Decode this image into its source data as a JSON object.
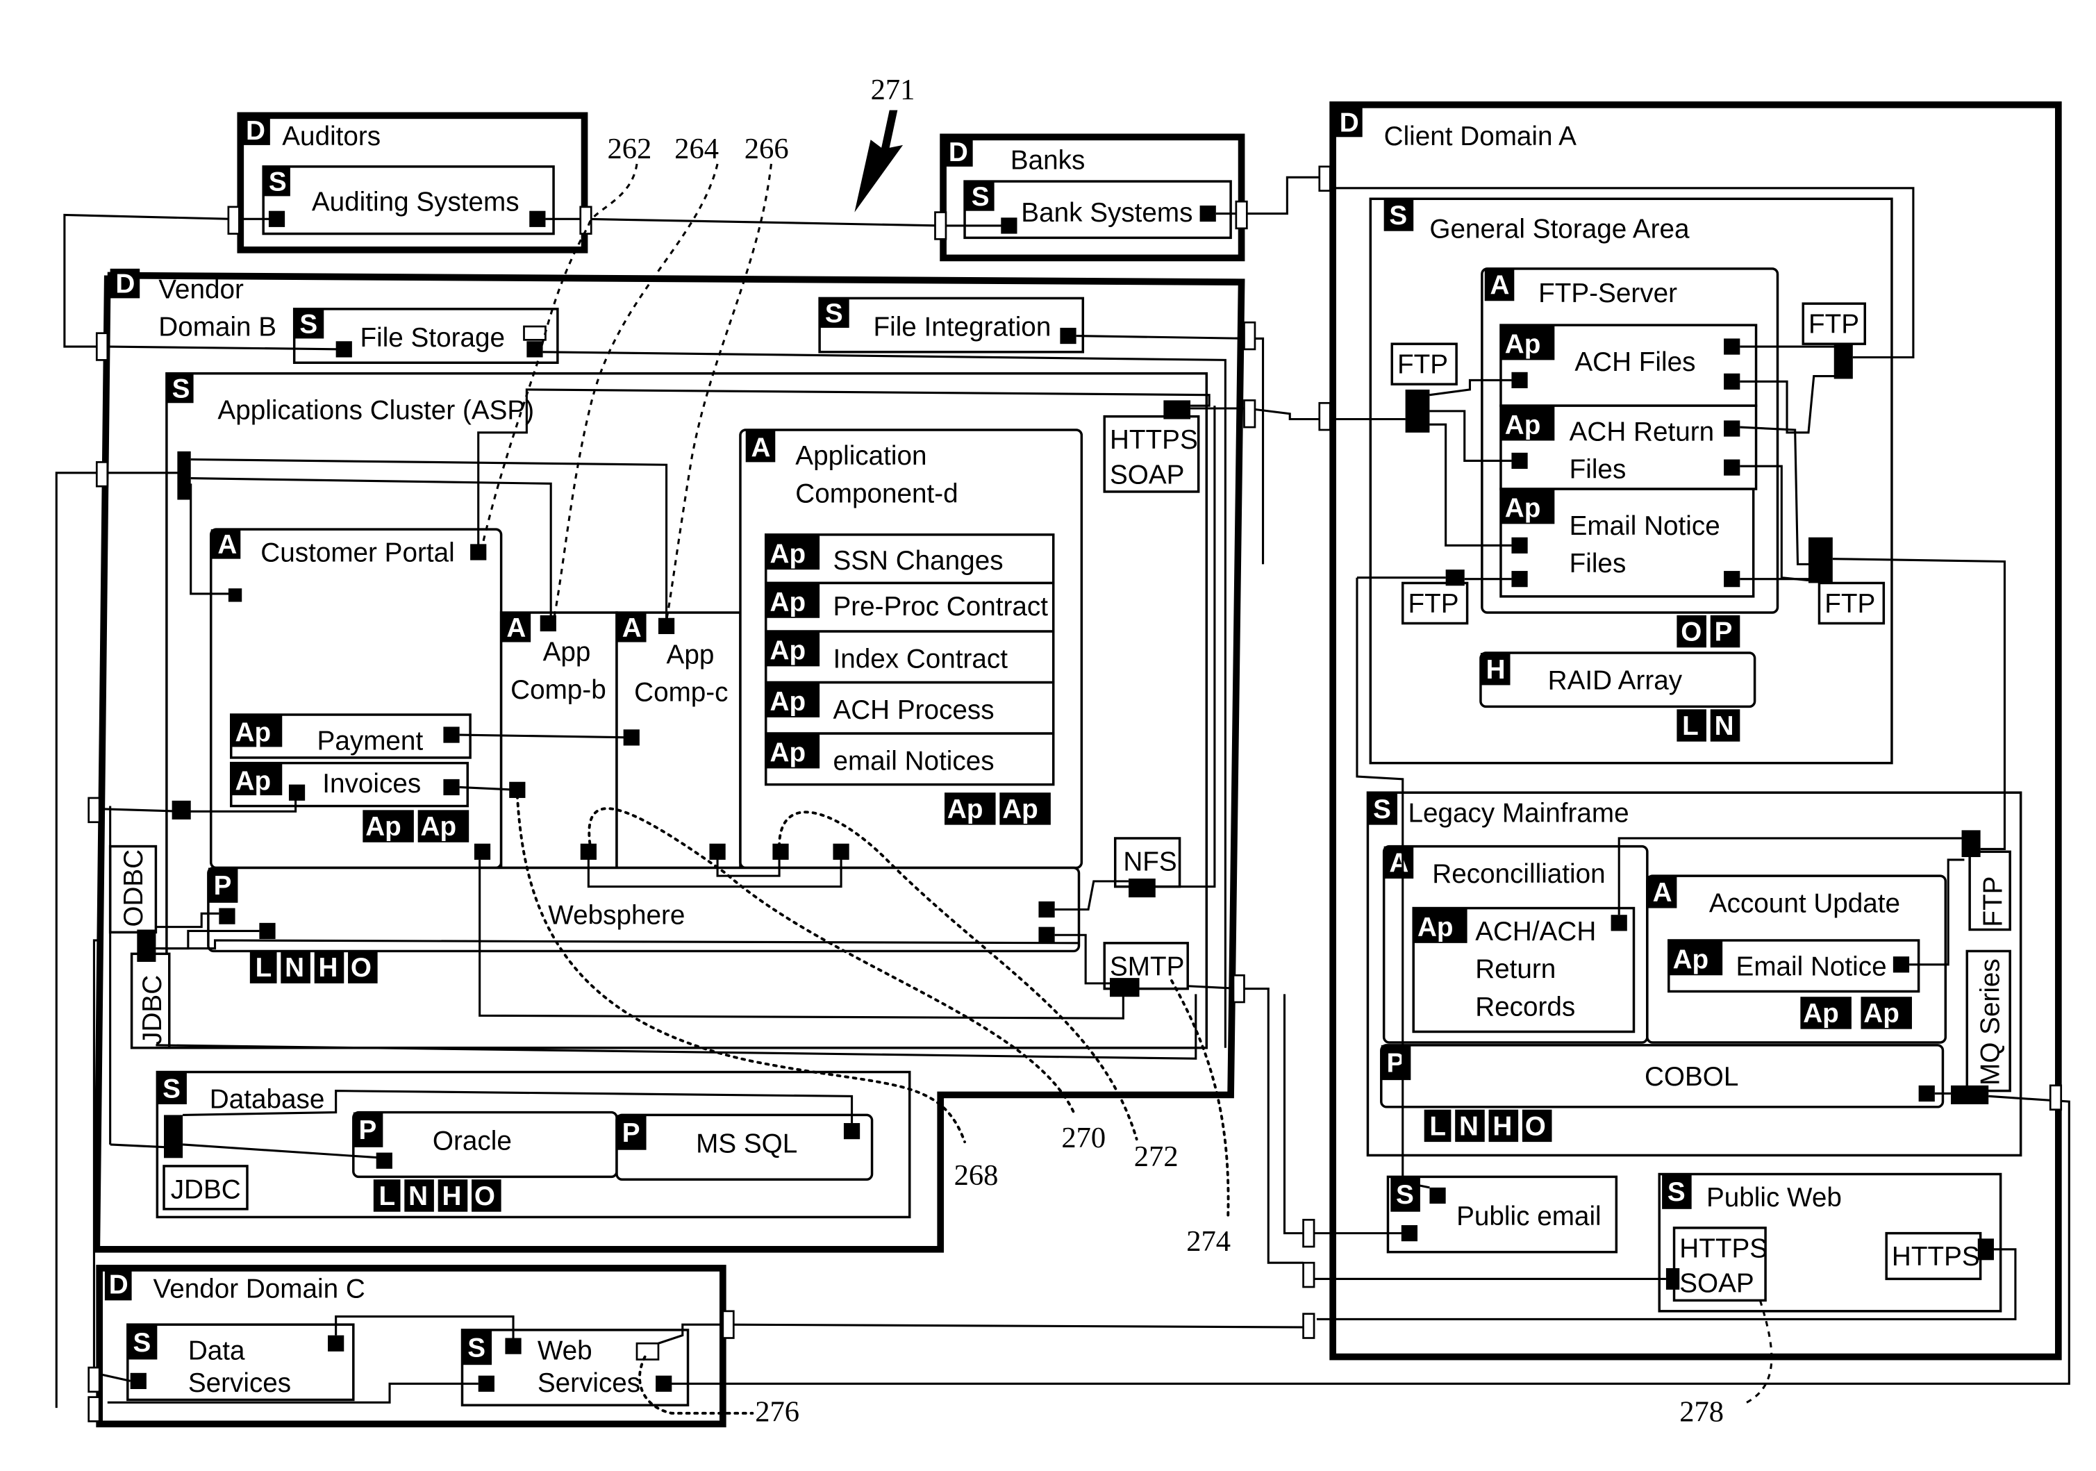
{
  "figure_ref": "271",
  "domains": {
    "auditors": {
      "tag": "D",
      "label": "Auditors",
      "systems": [
        {
          "tag": "S",
          "label": "Auditing Systems"
        }
      ]
    },
    "banks": {
      "tag": "D",
      "label": "Banks",
      "systems": [
        {
          "tag": "S",
          "label": "Bank Systems"
        }
      ]
    },
    "vendor_b": {
      "tag": "D",
      "label_line1": "Vendor",
      "label_line2": "Domain B",
      "file_storage": {
        "tag": "S",
        "label": "File Storage"
      },
      "file_integration": {
        "tag": "S",
        "label": "File Integration"
      },
      "apps_cluster": {
        "tag": "S",
        "label": "Applications Cluster (ASP)",
        "customer_portal": {
          "tag": "A",
          "label": "Customer Portal",
          "apps": [
            {
              "tag": "Ap",
              "label": "Payment"
            },
            {
              "tag": "Ap",
              "label": "Invoices"
            }
          ],
          "extra_tags": [
            "Ap",
            "Ap"
          ]
        },
        "app_comp_b": {
          "tag": "A",
          "line1": "App",
          "line2": "Comp-b"
        },
        "app_comp_c": {
          "tag": "A",
          "line1": "App",
          "line2": "Comp-c"
        },
        "app_comp_d": {
          "tag": "A",
          "line1": "Application",
          "line2": "Component-d",
          "apps": [
            {
              "tag": "Ap",
              "label": "SSN Changes"
            },
            {
              "tag": "Ap",
              "label": "Pre-Proc Contract"
            },
            {
              "tag": "Ap",
              "label": "Index Contract"
            },
            {
              "tag": "Ap",
              "label": "ACH Process"
            },
            {
              "tag": "Ap",
              "label": "email Notices"
            }
          ],
          "extra_tags": [
            "Ap",
            "Ap"
          ]
        },
        "platform": {
          "tag": "P",
          "label": "Websphere",
          "tags": [
            "L",
            "N",
            "H",
            "O"
          ]
        },
        "protocols": {
          "https_soap_1": "HTTPS",
          "https_soap_2": "SOAP",
          "nfs": "NFS",
          "smtp": "SMTP",
          "odbc": "ODBC",
          "jdbc": "JDBC"
        }
      },
      "database": {
        "tag": "S",
        "label": "Database",
        "jdbc": "JDBC",
        "platforms": [
          {
            "tag": "P",
            "label": "Oracle"
          },
          {
            "tag": "P",
            "label": "MS SQL"
          }
        ],
        "tags": [
          "L",
          "N",
          "H",
          "O"
        ]
      }
    },
    "vendor_c": {
      "tag": "D",
      "label": "Vendor Domain C",
      "data_services": {
        "tag": "S",
        "line1": "Data",
        "line2": "Services"
      },
      "web_services": {
        "tag": "S",
        "line1": "Web",
        "line2": "Services"
      }
    },
    "client_a": {
      "tag": "D",
      "label": "Client Domain A",
      "general_storage": {
        "tag": "S",
        "label": "General Storage Area",
        "ftp_server": {
          "tag": "A",
          "label": "FTP-Server",
          "apps": [
            {
              "tag": "Ap",
              "line1": "ACH Files",
              "line2": ""
            },
            {
              "tag": "Ap",
              "line1": "ACH Return",
              "line2": "Files"
            },
            {
              "tag": "Ap",
              "line1": "Email Notice",
              "line2": "Files"
            }
          ],
          "tags": [
            "O",
            "P"
          ]
        },
        "ftp_label": "FTP",
        "raid": {
          "tag": "H",
          "label": "RAID Array",
          "tags": [
            "L",
            "N"
          ]
        }
      },
      "legacy_mainframe": {
        "tag": "S",
        "label": "Legacy Mainframe",
        "reconciliation": {
          "tag": "A",
          "label": "Reconcilliation",
          "app": {
            "tag": "Ap",
            "line1": "ACH/ACH",
            "line2": "Return",
            "line3": "Records"
          }
        },
        "account_update": {
          "tag": "A",
          "label": "Account Update",
          "app": {
            "tag": "Ap",
            "label": "Email Notice"
          },
          "extra_tags": [
            "Ap",
            "Ap"
          ]
        },
        "platform": {
          "tag": "P",
          "label": "COBOL",
          "tags": [
            "L",
            "N",
            "H",
            "O"
          ]
        },
        "ftp": "FTP",
        "mq": "MQ Series"
      },
      "public_email": {
        "tag": "S",
        "label": "Public email"
      },
      "public_web": {
        "tag": "S",
        "label": "Public Web",
        "https_soap_1": "HTTPS",
        "https_soap_2": "SOAP",
        "https": "HTTPS"
      }
    }
  },
  "reference_numerals": [
    "262",
    "264",
    "266",
    "268",
    "270",
    "272",
    "274",
    "276",
    "278"
  ]
}
